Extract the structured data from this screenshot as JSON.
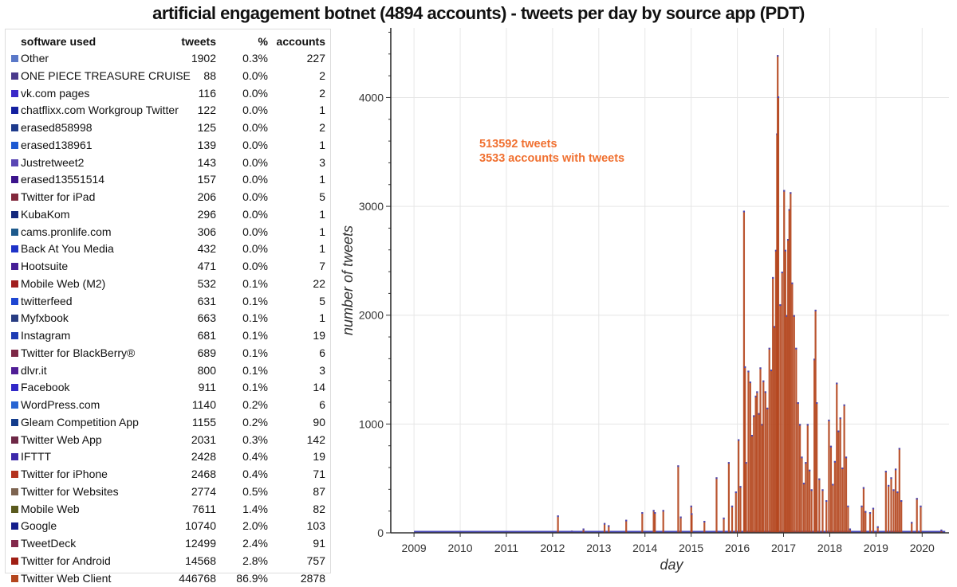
{
  "title": "artificial engagement botnet (4894 accounts) - tweets per day by source app (PDT)",
  "legend_table": {
    "headers": {
      "name": "software used",
      "tweets": "tweets",
      "pct": "%",
      "accounts": "accounts"
    },
    "rows": [
      {
        "name": "Other",
        "tweets": "1902",
        "pct": "0.3%",
        "accounts": "227",
        "color": "#5a78c8"
      },
      {
        "name": "ONE PIECE TREASURE CRUISE",
        "tweets": "88",
        "pct": "0.0%",
        "accounts": "2",
        "color": "#4a3a8c"
      },
      {
        "name": "vk.com pages",
        "tweets": "116",
        "pct": "0.0%",
        "accounts": "2",
        "color": "#3a28c8"
      },
      {
        "name": "chatflixx.com Workgroup Twitter",
        "tweets": "122",
        "pct": "0.0%",
        "accounts": "1",
        "color": "#1420a0"
      },
      {
        "name": "erased858998",
        "tweets": "125",
        "pct": "0.0%",
        "accounts": "2",
        "color": "#1e3a8c"
      },
      {
        "name": "erased138961",
        "tweets": "139",
        "pct": "0.0%",
        "accounts": "1",
        "color": "#1e5ad2"
      },
      {
        "name": "Justretweet2",
        "tweets": "143",
        "pct": "0.0%",
        "accounts": "3",
        "color": "#5a46b4"
      },
      {
        "name": "erased13551514",
        "tweets": "157",
        "pct": "0.0%",
        "accounts": "1",
        "color": "#3c148c"
      },
      {
        "name": "Twitter for iPad",
        "tweets": "206",
        "pct": "0.0%",
        "accounts": "5",
        "color": "#82283c"
      },
      {
        "name": "KubaKom",
        "tweets": "296",
        "pct": "0.0%",
        "accounts": "1",
        "color": "#14287c"
      },
      {
        "name": "cams.pronlife.com",
        "tweets": "306",
        "pct": "0.0%",
        "accounts": "1",
        "color": "#1e5a8c"
      },
      {
        "name": "Back At You Media",
        "tweets": "432",
        "pct": "0.0%",
        "accounts": "1",
        "color": "#1e32c8"
      },
      {
        "name": "Hootsuite",
        "tweets": "471",
        "pct": "0.0%",
        "accounts": "7",
        "color": "#461e96"
      },
      {
        "name": "Mobile Web (M2)",
        "tweets": "532",
        "pct": "0.1%",
        "accounts": "22",
        "color": "#a01e1e"
      },
      {
        "name": "twitterfeed",
        "tweets": "631",
        "pct": "0.1%",
        "accounts": "5",
        "color": "#1e46d2"
      },
      {
        "name": "Myfxbook",
        "tweets": "663",
        "pct": "0.1%",
        "accounts": "1",
        "color": "#283c82"
      },
      {
        "name": "Instagram",
        "tweets": "681",
        "pct": "0.1%",
        "accounts": "19",
        "color": "#1e3cb4"
      },
      {
        "name": "Twitter for BlackBerry®",
        "tweets": "689",
        "pct": "0.1%",
        "accounts": "6",
        "color": "#7d2846"
      },
      {
        "name": "dlvr.it",
        "tweets": "800",
        "pct": "0.1%",
        "accounts": "3",
        "color": "#501e96"
      },
      {
        "name": "Facebook",
        "tweets": "911",
        "pct": "0.1%",
        "accounts": "14",
        "color": "#3228c8"
      },
      {
        "name": "WordPress.com",
        "tweets": "1140",
        "pct": "0.2%",
        "accounts": "6",
        "color": "#2864d2"
      },
      {
        "name": "Gleam Competition App",
        "tweets": "1155",
        "pct": "0.2%",
        "accounts": "90",
        "color": "#143c8c"
      },
      {
        "name": "Twitter Web App",
        "tweets": "2031",
        "pct": "0.3%",
        "accounts": "142",
        "color": "#6e2846"
      },
      {
        "name": "IFTTT",
        "tweets": "2428",
        "pct": "0.4%",
        "accounts": "19",
        "color": "#3c28aa"
      },
      {
        "name": "Twitter for iPhone",
        "tweets": "2468",
        "pct": "0.4%",
        "accounts": "71",
        "color": "#b4321e"
      },
      {
        "name": "Twitter for Websites",
        "tweets": "2774",
        "pct": "0.5%",
        "accounts": "87",
        "color": "#7d6450"
      },
      {
        "name": "Mobile Web",
        "tweets": "7611",
        "pct": "1.4%",
        "accounts": "82",
        "color": "#5a5a1e"
      },
      {
        "name": "Google",
        "tweets": "10740",
        "pct": "2.0%",
        "accounts": "103",
        "color": "#141e8c"
      },
      {
        "name": "TweetDeck",
        "tweets": "12499",
        "pct": "2.4%",
        "accounts": "91",
        "color": "#82284b"
      },
      {
        "name": "Twitter for Android",
        "tweets": "14568",
        "pct": "2.8%",
        "accounts": "757",
        "color": "#a01e14"
      },
      {
        "name": "Twitter Web Client",
        "tweets": "446768",
        "pct": "86.9%",
        "accounts": "2878",
        "color": "#b4461e"
      }
    ]
  },
  "chart_data": {
    "type": "bar",
    "xlabel": "day",
    "ylabel": "number of tweets",
    "xlim": [
      "2008-07-01",
      "2020-08-01"
    ],
    "ylim": [
      0,
      4640
    ],
    "x_ticks": [
      "2009",
      "2010",
      "2011",
      "2012",
      "2013",
      "2014",
      "2015",
      "2016",
      "2017",
      "2018",
      "2019",
      "2020"
    ],
    "y_ticks": [
      "0",
      "1000",
      "2000",
      "3000",
      "4000"
    ],
    "grid": true,
    "stacked": true,
    "annotations": [
      "513592 tweets",
      "3533 accounts with tweets"
    ],
    "bar_color": "#b4461e",
    "overlay_color": "#4848b8",
    "points": [
      [
        "2008-12-20",
        4
      ],
      [
        "2009-06-01",
        3
      ],
      [
        "2010-01-15",
        4
      ],
      [
        "2010-06-01",
        12
      ],
      [
        "2010-09-10",
        10
      ],
      [
        "2011-01-20",
        14
      ],
      [
        "2011-05-01",
        8
      ],
      [
        "2011-09-01",
        10
      ],
      [
        "2012-02-12",
        160
      ],
      [
        "2012-06-01",
        20
      ],
      [
        "2012-09-01",
        40
      ],
      [
        "2013-02-15",
        90
      ],
      [
        "2013-03-20",
        70
      ],
      [
        "2013-08-05",
        120
      ],
      [
        "2013-12-10",
        190
      ],
      [
        "2014-03-10",
        210
      ],
      [
        "2014-03-20",
        190
      ],
      [
        "2014-05-25",
        210
      ],
      [
        "2014-09-20",
        620
      ],
      [
        "2014-10-10",
        150
      ],
      [
        "2015-01-01",
        250
      ],
      [
        "2015-01-05",
        180
      ],
      [
        "2015-04-15",
        110
      ],
      [
        "2015-07-20",
        510
      ],
      [
        "2015-09-15",
        140
      ],
      [
        "2015-10-25",
        650
      ],
      [
        "2015-11-20",
        250
      ],
      [
        "2015-12-20",
        380
      ],
      [
        "2016-01-10",
        860
      ],
      [
        "2016-01-25",
        430
      ],
      [
        "2016-02-22",
        2960
      ],
      [
        "2016-03-01",
        1530
      ],
      [
        "2016-03-10",
        650
      ],
      [
        "2016-03-28",
        1490
      ],
      [
        "2016-04-12",
        1390
      ],
      [
        "2016-04-25",
        900
      ],
      [
        "2016-05-10",
        1080
      ],
      [
        "2016-05-25",
        1260
      ],
      [
        "2016-06-05",
        1300
      ],
      [
        "2016-06-20",
        1100
      ],
      [
        "2016-07-01",
        1520
      ],
      [
        "2016-07-15",
        1000
      ],
      [
        "2016-07-25",
        1400
      ],
      [
        "2016-08-10",
        1300
      ],
      [
        "2016-08-25",
        1150
      ],
      [
        "2016-09-10",
        1700
      ],
      [
        "2016-09-25",
        1500
      ],
      [
        "2016-10-08",
        2350
      ],
      [
        "2016-10-20",
        1900
      ],
      [
        "2016-11-01",
        2600
      ],
      [
        "2016-11-10",
        3670
      ],
      [
        "2016-11-15",
        4390
      ],
      [
        "2016-11-20",
        4010
      ],
      [
        "2016-12-05",
        2100
      ],
      [
        "2016-12-20",
        2400
      ],
      [
        "2017-01-05",
        3150
      ],
      [
        "2017-01-15",
        2600
      ],
      [
        "2017-01-25",
        2000
      ],
      [
        "2017-02-05",
        2700
      ],
      [
        "2017-02-15",
        2975
      ],
      [
        "2017-02-25",
        3130
      ],
      [
        "2017-03-10",
        2300
      ],
      [
        "2017-03-25",
        2000
      ],
      [
        "2017-04-10",
        1700
      ],
      [
        "2017-04-25",
        1200
      ],
      [
        "2017-05-10",
        1000
      ],
      [
        "2017-05-25",
        700
      ],
      [
        "2017-06-10",
        460
      ],
      [
        "2017-06-25",
        650
      ],
      [
        "2017-07-10",
        1000
      ],
      [
        "2017-07-25",
        580
      ],
      [
        "2017-08-10",
        400
      ],
      [
        "2017-09-01",
        1600
      ],
      [
        "2017-09-10",
        2050
      ],
      [
        "2017-09-20",
        1200
      ],
      [
        "2017-10-10",
        500
      ],
      [
        "2017-11-05",
        400
      ],
      [
        "2017-12-05",
        300
      ],
      [
        "2017-12-25",
        1040
      ],
      [
        "2018-01-10",
        800
      ],
      [
        "2018-01-25",
        450
      ],
      [
        "2018-02-10",
        660
      ],
      [
        "2018-02-25",
        1380
      ],
      [
        "2018-03-10",
        940
      ],
      [
        "2018-03-25",
        1060
      ],
      [
        "2018-04-10",
        600
      ],
      [
        "2018-04-25",
        1180
      ],
      [
        "2018-05-10",
        700
      ],
      [
        "2018-05-25",
        250
      ],
      [
        "2018-06-10",
        40
      ],
      [
        "2018-09-10",
        250
      ],
      [
        "2018-09-25",
        420
      ],
      [
        "2018-10-10",
        200
      ],
      [
        "2018-11-15",
        190
      ],
      [
        "2018-12-10",
        230
      ],
      [
        "2019-01-15",
        60
      ],
      [
        "2019-03-20",
        570
      ],
      [
        "2019-04-10",
        440
      ],
      [
        "2019-05-01",
        510
      ],
      [
        "2019-05-20",
        400
      ],
      [
        "2019-06-05",
        590
      ],
      [
        "2019-06-20",
        380
      ],
      [
        "2019-07-05",
        780
      ],
      [
        "2019-07-20",
        300
      ],
      [
        "2019-10-10",
        100
      ],
      [
        "2019-11-20",
        320
      ],
      [
        "2019-12-20",
        250
      ],
      [
        "2020-03-01",
        15
      ],
      [
        "2020-06-01",
        30
      ]
    ]
  }
}
